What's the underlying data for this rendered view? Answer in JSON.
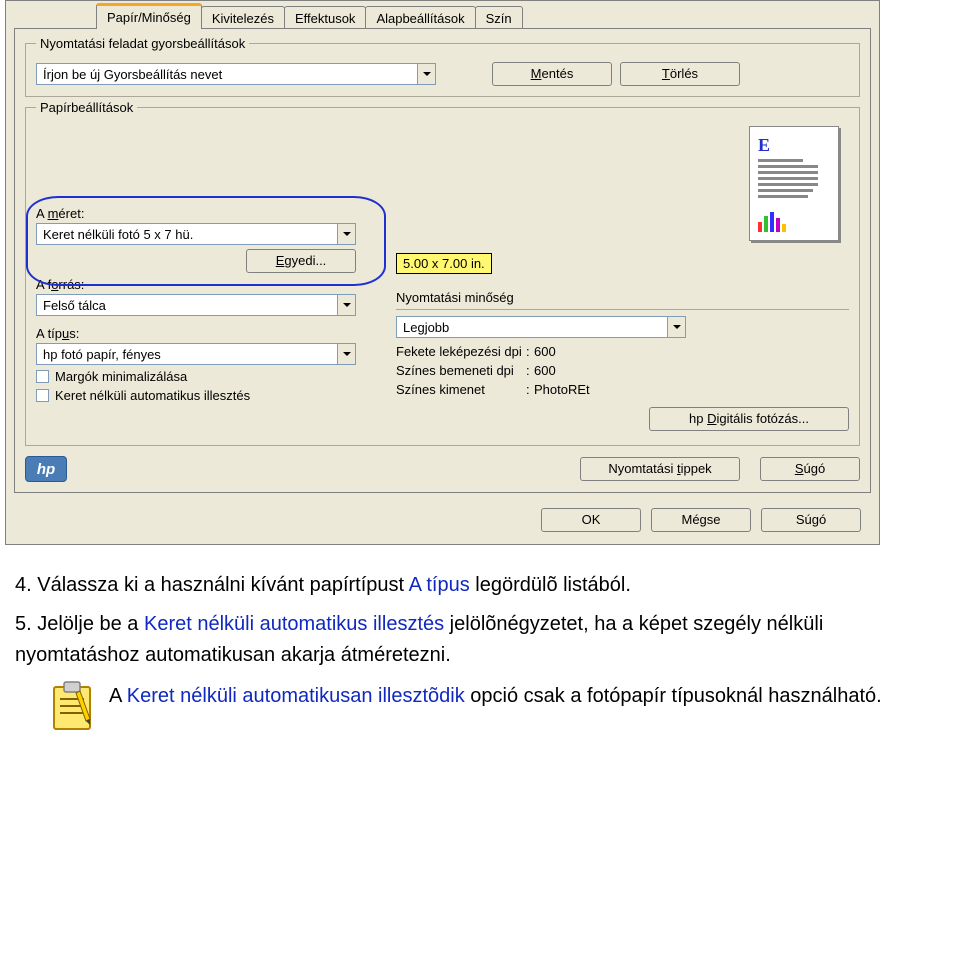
{
  "tabs": [
    "Papír/Minőség",
    "Kivitelezés",
    "Effektusok",
    "Alapbeállítások",
    "Szín"
  ],
  "group1": {
    "title": "Nyomtatási feladat gyorsbeállítások",
    "combo": "Írjon be új Gyorsbeállítás nevet",
    "save": "Mentés",
    "delete": "Törlés"
  },
  "group2": {
    "title": "Papírbeállítások",
    "size_label": "A méret:",
    "size_value": "Keret nélküli fotó 5 x 7 hü.",
    "custom": "Egyedi...",
    "source_label": "A forrás:",
    "source_value": "Felső tálca",
    "type_label": "A típus:",
    "type_value": "hp fotó papír, fényes",
    "chk1": "Margók minimalizálása",
    "chk2": "Keret nélküli automatikus illesztés",
    "dimensions": "5.00 x 7.00 in.",
    "quality_title": "Nyomtatási minőség",
    "quality_value": "Legjobb",
    "info": {
      "r1a": "Fekete leképezési dpi",
      "r1b": ":",
      "r1c": "600",
      "r2a": "Színes bemeneti dpi",
      "r2b": ":",
      "r2c": "600",
      "r3a": "Színes kimenet",
      "r3b": ":",
      "r3c": "PhotoREt"
    },
    "digital_btn": "hp Digitális fotózás..."
  },
  "tips_btn": "Nyomtatási tippek",
  "help_btn": "Súgó",
  "ok": "OK",
  "cancel": "Mégse",
  "help2": "Súgó",
  "text": {
    "line1a": "4.  Válassza ki a használni kívánt papírtípust ",
    "line1b": "A típus",
    "line1c": " legördülõ listából.",
    "line2a": "5.  Jelölje be a ",
    "line2b": "Keret nélküli automatikus illesztés",
    "line2c": " jelölõnégyzetet, ha a képet szegély nélküli nyomtatáshoz automatikusan akarja átméretezni.",
    "note_a": "A ",
    "note_b": "Keret nélküli automatikusan illesztõdik",
    "note_c": " opció csak a fotópapír típusoknál használható."
  }
}
